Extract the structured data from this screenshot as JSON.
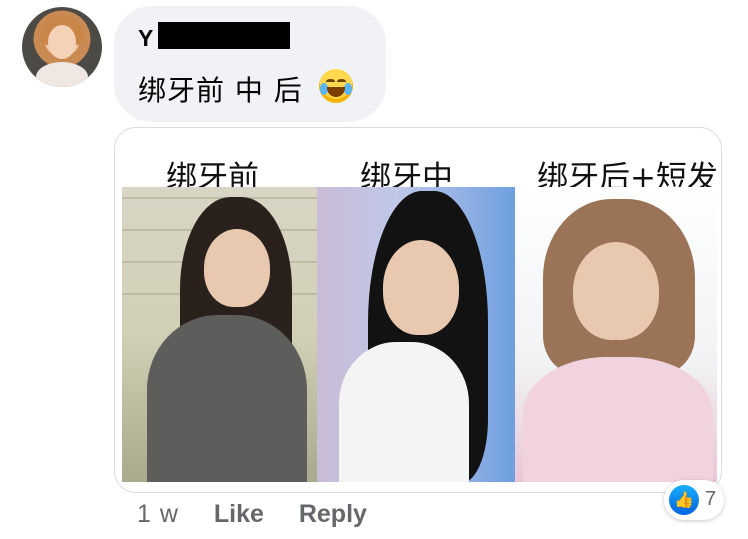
{
  "comment": {
    "author_visible": "Y",
    "text": "绑牙前 中 后"
  },
  "attachment": {
    "panels": [
      {
        "label": "绑牙前"
      },
      {
        "label": "绑牙中"
      },
      {
        "label": "绑牙后+短发"
      }
    ]
  },
  "actions": {
    "time": "1 w",
    "like": "Like",
    "reply": "Reply"
  },
  "reactions": {
    "icon": "thumbs-up-icon",
    "count": "7",
    "color": "#1877f2"
  },
  "colors": {
    "bubble": "#f0f2f5",
    "secondary_text": "#65676b"
  }
}
